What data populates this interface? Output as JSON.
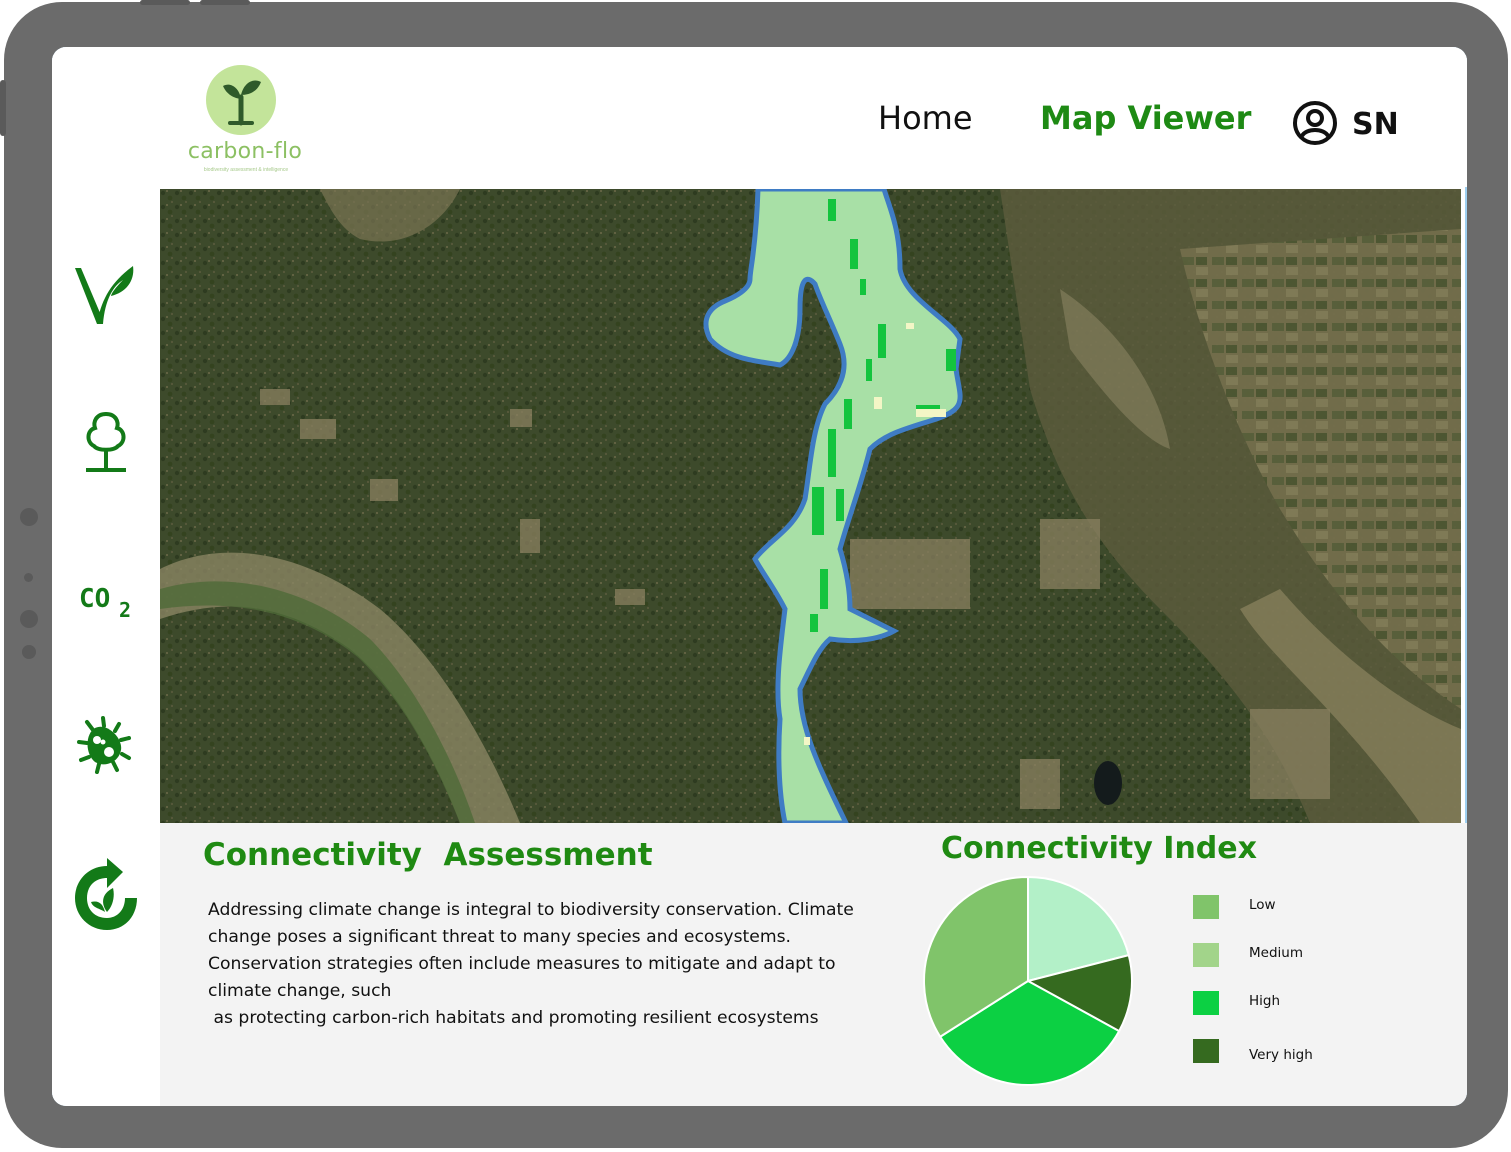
{
  "brand": {
    "name": "carbon-flo",
    "tagline": "biodiversity assessment & intelligence"
  },
  "nav": {
    "home": "Home",
    "map_viewer": "Map Viewer",
    "active": "map_viewer",
    "user_initials": "SN"
  },
  "sidebar": {
    "items": [
      {
        "icon": "biodiversity-leaf-icon"
      },
      {
        "icon": "tree-icon"
      },
      {
        "icon": "co2-icon"
      },
      {
        "icon": "bacteria-icon"
      },
      {
        "icon": "recycle-leaf-icon"
      }
    ]
  },
  "assessment": {
    "title": "Connectivity  Assessment",
    "lines": [
      "Addressing climate change is integral to biodiversity conservation. Climate",
      "change poses a significant threat to many species and ecosystems.",
      "Conservation strategies often include measures to mitigate and adapt to",
      "climate change, such",
      " as protecting carbon-rich habitats and promoting resilient ecosystems"
    ]
  },
  "chart_data": {
    "type": "pie",
    "title": "Connectivity Index",
    "slices": [
      {
        "label": "Low",
        "value": 34,
        "color": "#80c46a"
      },
      {
        "label": "Medium",
        "value": 21,
        "color": "#b3f0c8"
      },
      {
        "label": "High",
        "value": 33,
        "color": "#0cd043"
      },
      {
        "label": "Very high",
        "value": 12,
        "color": "#356a1f"
      }
    ],
    "legend": [
      {
        "label": "Low",
        "color": "#80c46a"
      },
      {
        "label": "Medium",
        "color": "#a2d48a"
      },
      {
        "label": "High",
        "color": "#0cd043"
      },
      {
        "label": "Very high",
        "color": "#356a1f"
      }
    ],
    "legend_position": "right"
  },
  "colors": {
    "brand_green": "#1f8a12",
    "corridor_fill": "#a8e0a6",
    "corridor_outline": "#3f7cc4"
  }
}
